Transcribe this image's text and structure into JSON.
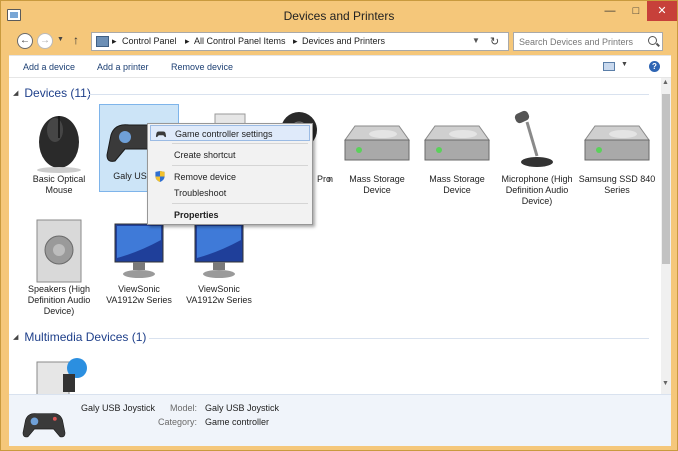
{
  "window": {
    "title": "Devices and Printers"
  },
  "address": {
    "crumbs": [
      "Control Panel",
      "All Control Panel Items",
      "Devices and Printers"
    ],
    "search_placeholder": "Search Devices and Printers"
  },
  "toolbar": {
    "add_device": "Add a device",
    "add_printer": "Add a printer",
    "remove_device": "Remove device"
  },
  "groups": {
    "devices": {
      "title": "Devices (11)"
    },
    "multimedia": {
      "title": "Multimedia Devices (1)"
    }
  },
  "devices": [
    {
      "label": "Basic Optical Mouse",
      "icon": "mouse-icon"
    },
    {
      "label": "Galy USB Jo",
      "icon": "gamepad-icon"
    },
    {
      "label": "",
      "icon": "printer-icon"
    },
    {
      "label": "n",
      "icon": "webcam-icon"
    },
    {
      "label": "Pro",
      "icon": "drive-icon"
    },
    {
      "label": "Mass Storage Device",
      "icon": "drive-icon"
    },
    {
      "label": "Mass Storage Device",
      "icon": "drive-icon"
    },
    {
      "label": "Microphone (High Definition Audio Device)",
      "icon": "microphone-icon"
    },
    {
      "label": "Samsung SSD 840 Series",
      "icon": "drive-icon"
    },
    {
      "label": "Speakers (High Definition Audio Device)",
      "icon": "speaker-icon"
    },
    {
      "label": "ViewSonic VA1912w Series",
      "icon": "monitor-icon"
    },
    {
      "label": "ViewSonic VA1912w Series",
      "icon": "monitor-icon"
    }
  ],
  "context_menu": {
    "items": [
      {
        "label": "Game controller settings",
        "icon": "gamepad-icon"
      },
      {
        "label": "Create shortcut"
      },
      {
        "label": "Remove device",
        "icon": "shield-icon"
      },
      {
        "label": "Troubleshoot"
      },
      {
        "label": "Properties"
      }
    ]
  },
  "details": {
    "name": "Galy USB Joystick",
    "model_label": "Model:",
    "model_value": "Galy USB Joystick",
    "category_label": "Category:",
    "category_value": "Game controller"
  },
  "colors": {
    "accent": "#1e3f8a",
    "selection": "#cce4f7",
    "frame": "#f5c77a"
  }
}
